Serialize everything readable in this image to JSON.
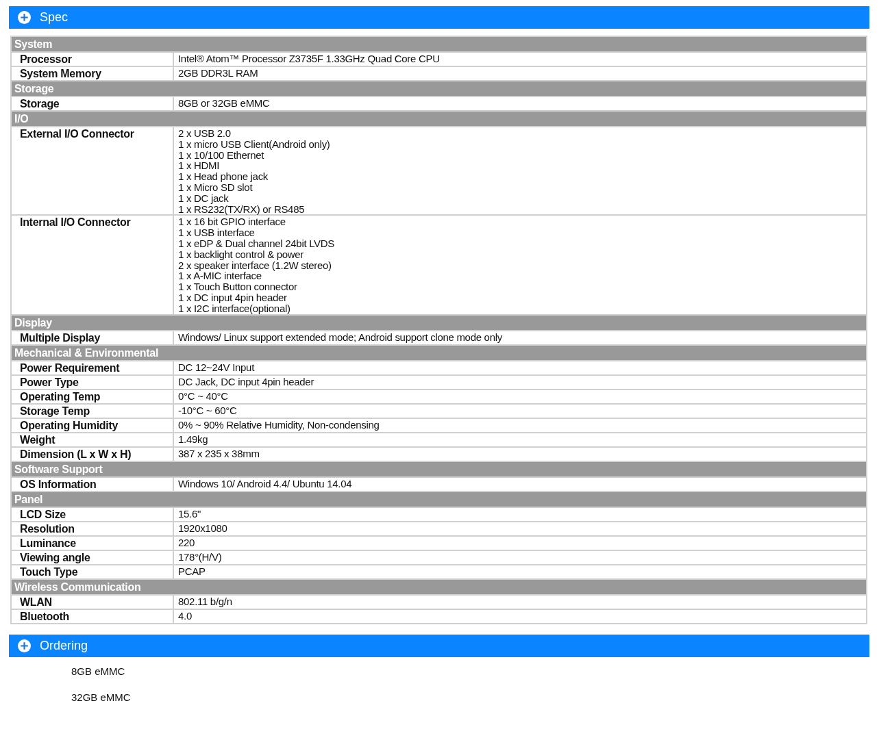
{
  "spec_panel": {
    "title": "Spec",
    "sections": [
      {
        "title": "System",
        "rows": [
          {
            "label": "Processor",
            "lines": [
              "Intel® Atom™ Processor Z3735F 1.33GHz Quad Core CPU"
            ]
          },
          {
            "label": "System Memory",
            "lines": [
              "2GB DDR3L RAM"
            ]
          }
        ]
      },
      {
        "title": "Storage",
        "rows": [
          {
            "label": "Storage",
            "lines": [
              "8GB or 32GB eMMC"
            ]
          }
        ]
      },
      {
        "title": "I/O",
        "rows": [
          {
            "label": "External I/O Connector",
            "lines": [
              "2 x USB 2.0",
              "1 x micro USB Client(Android only)",
              "1 x 10/100 Ethernet",
              "1 x HDMI",
              "1 x Head phone jack",
              "1 x Micro SD slot",
              "1 x DC jack",
              "1 x RS232(TX/RX) or RS485"
            ]
          },
          {
            "label": "Internal I/O Connector",
            "lines": [
              "1 x 16 bit GPIO interface",
              "1 x USB interface",
              "1 x eDP & Dual channel 24bit LVDS",
              "1 x backlight control & power",
              "2 x speaker interface (1.2W stereo)",
              "1 x A-MIC interface",
              "1 x Touch Button connector",
              "1 x DC input 4pin header",
              "1 x I2C interface(optional)"
            ]
          }
        ]
      },
      {
        "title": "Display",
        "rows": [
          {
            "label": "Multiple Display",
            "lines": [
              "Windows/ Linux support extended mode; Android support clone mode only"
            ]
          }
        ]
      },
      {
        "title": "Mechanical & Environmental",
        "rows": [
          {
            "label": "Power Requirement",
            "lines": [
              "DC 12~24V Input"
            ]
          },
          {
            "label": "Power Type",
            "lines": [
              "DC Jack, DC input 4pin header"
            ]
          },
          {
            "label": "Operating Temp",
            "lines": [
              "0°C ~ 40°C"
            ]
          },
          {
            "label": "Storage Temp",
            "lines": [
              "-10°C ~ 60°C"
            ]
          },
          {
            "label": "Operating Humidity",
            "lines": [
              "0% ~ 90% Relative Humidity, Non-condensing"
            ]
          },
          {
            "label": "Weight",
            "lines": [
              "1.49kg"
            ]
          },
          {
            "label": "Dimension (L x W x H)",
            "lines": [
              "387 x 235 x 38mm"
            ]
          }
        ]
      },
      {
        "title": "Software Support",
        "rows": [
          {
            "label": "OS Information",
            "lines": [
              "Windows 10/ Android 4.4/ Ubuntu 14.04"
            ]
          }
        ]
      },
      {
        "title": "Panel",
        "rows": [
          {
            "label": "LCD Size",
            "lines": [
              "15.6\""
            ]
          },
          {
            "label": "Resolution",
            "lines": [
              "1920x1080"
            ]
          },
          {
            "label": "Luminance",
            "lines": [
              "220"
            ]
          },
          {
            "label": "Viewing angle",
            "lines": [
              "178°(H/V)"
            ]
          },
          {
            "label": "Touch Type",
            "lines": [
              "PCAP"
            ]
          }
        ]
      },
      {
        "title": "Wireless Communication",
        "rows": [
          {
            "label": "WLAN",
            "lines": [
              "802.11 b/g/n"
            ]
          },
          {
            "label": "Bluetooth",
            "lines": [
              "4.0"
            ]
          }
        ]
      }
    ]
  },
  "ordering_panel": {
    "title": "Ordering",
    "items": [
      "8GB eMMC",
      "32GB eMMC"
    ]
  }
}
